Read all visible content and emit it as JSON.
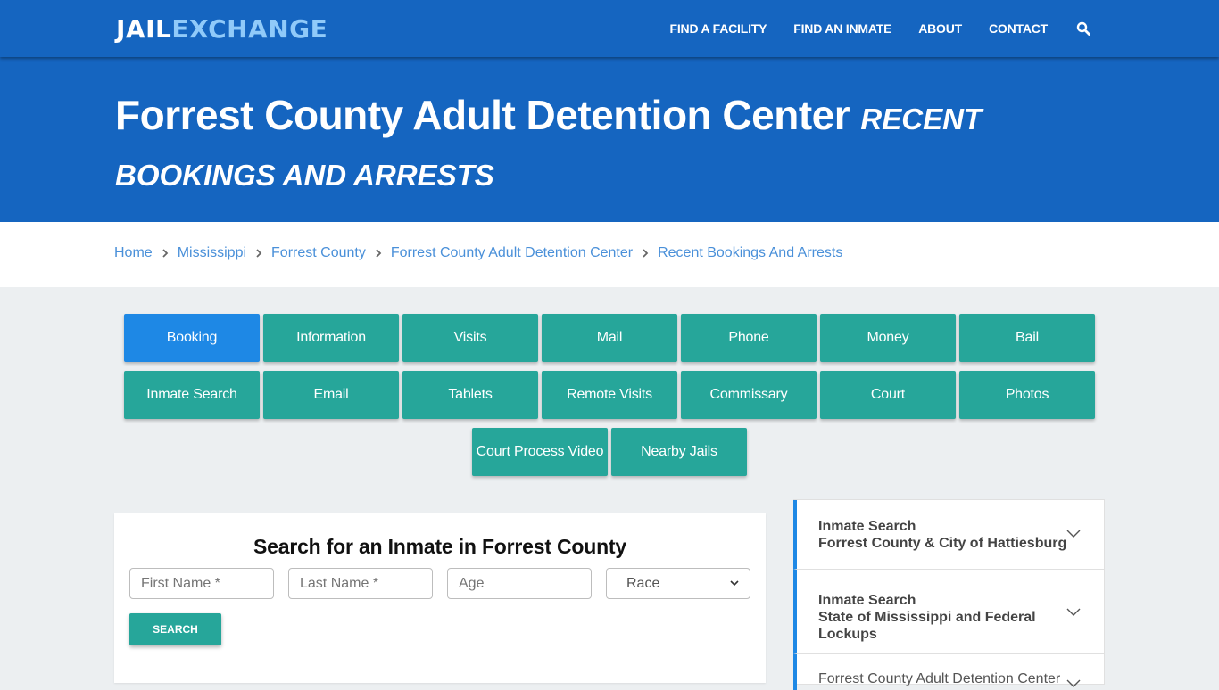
{
  "navbar": {
    "logo_part1": "JAIL",
    "logo_part2": "EXCHANGE",
    "links": [
      "FIND A FACILITY",
      "FIND AN INMATE",
      "ABOUT",
      "CONTACT"
    ],
    "search_icon": "search-icon",
    "colors": {
      "bg": "#1565c0",
      "logo_accent": "#90caf9"
    }
  },
  "hero": {
    "title": "Forrest County Adult Detention Center",
    "subtitle": "Recent Bookings And Arrests"
  },
  "breadcrumb": [
    "Home",
    "Mississippi",
    "Forrest County",
    "Forrest County Adult Detention Center",
    "Recent Bookings And Arrests"
  ],
  "tiles": {
    "row1": [
      "Booking",
      "Information",
      "Visits",
      "Mail",
      "Phone",
      "Money",
      "Bail"
    ],
    "row2": [
      "Inmate Search",
      "Email",
      "Tablets",
      "Remote Visits",
      "Commissary",
      "Court",
      "Photos"
    ],
    "row3": [
      "Court Process Video",
      "Nearby Jails"
    ],
    "active": "Booking",
    "colors": {
      "default": "#26a69a",
      "active": "#1e88e5"
    }
  },
  "search": {
    "title": "Search for an Inmate in Forrest County",
    "first_name_placeholder": "First Name *",
    "last_name_placeholder": "Last Name *",
    "age_placeholder": "Age",
    "race_selected": "Race",
    "button_label": "SEARCH"
  },
  "sidebar": {
    "items": [
      {
        "line1": "Inmate Search",
        "line2": "Forrest County & City of Hattiesburg"
      },
      {
        "line1": "Inmate Search",
        "line2": "State of Mississippi and Federal Lockups"
      },
      {
        "line1": "Forrest County Adult Detention Center"
      }
    ]
  }
}
